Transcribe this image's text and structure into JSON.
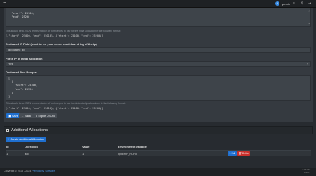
{
  "topbar": {
    "user_initial": "A",
    "user_name": "ga-min",
    "icons": [
      "bars-icon",
      "list-icon",
      "cog-icon",
      "sign-out-icon"
    ]
  },
  "form": {
    "ports_json_preview": [
      "\"start\": 25100,",
      "\"end\": 25200"
    ],
    "ports_help": "This should be a JSON representation of port ranges to use for the initial allocation in the following format:",
    "ports_format": "[{\"start\": 25000, \"end\": 25010}, {\"start\": 25100, \"end\": 25200}]",
    "dedicated_ip_label": "Dedicated IP Field (must be on your server model as string of the ip)",
    "dedicated_ip_value": "dedicated_ip",
    "force_ip_label": "Force IP of Initial Allocation",
    "force_ip_value": "Yes",
    "dedicated_ports_label": "Dedicated Port Ranges",
    "dedicated_ports_json": [
      "[",
      "  {",
      "    \"start\": 25300,",
      "    \"end\": 25320",
      "  }",
      "]"
    ],
    "dedicated_ports_help": "This should be a JSON representation of port ranges to use for dedicated ip allocations in the following format:",
    "dedicated_ports_format": "[{\"start\": 25000, \"end\": 25010}, {\"start\": 25100, \"end\": 25200}]",
    "buttons": {
      "save": "Save",
      "back": "Back",
      "export": "Export JSON"
    }
  },
  "allocations": {
    "title": "Additional Allocations",
    "create_label": "Create Additional Allocation",
    "columns": [
      "Id",
      "Operation",
      "Value",
      "Environment Variable"
    ],
    "rows": [
      {
        "id": "1",
        "operation": "add",
        "value": "1",
        "env": "QUERY_PORT",
        "edit": "Edit",
        "delete": "Delete"
      }
    ]
  },
  "footer": {
    "copyright": "Copyright © 2015 - 2024",
    "link": "Pterodactyl Software",
    "version_lines": [
      "v 1.11.10",
      "0.047s"
    ]
  }
}
